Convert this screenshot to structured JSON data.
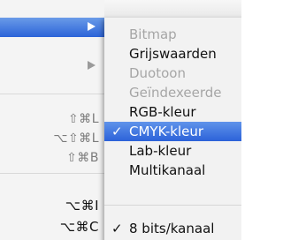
{
  "parent_menu": {
    "shortcuts": {
      "rgb": "⇧⌘L",
      "cmyk": "⌥⇧⌘L",
      "lab": "⇧⌘B",
      "image_size": "⌥⌘I",
      "canvas_size": "⌥⌘C"
    }
  },
  "submenu": {
    "items": [
      {
        "label": "Bitmap",
        "enabled": false
      },
      {
        "label": "Grijswaarden",
        "enabled": true
      },
      {
        "label": "Duotoon",
        "enabled": false
      },
      {
        "label": "Geïndexeerde",
        "enabled": false
      },
      {
        "label": "RGB-kleur",
        "enabled": true
      },
      {
        "label": "CMYK-kleur",
        "enabled": true,
        "selected": true,
        "checked": true
      },
      {
        "label": "Lab-kleur",
        "enabled": true
      },
      {
        "label": "Multikanaal",
        "enabled": true
      }
    ],
    "bits_item": {
      "label": "8 bits/kanaal",
      "checked": true
    },
    "check_glyph": "✓"
  },
  "colors": {
    "selection": "#2c62d9",
    "disabled_text": "#a6a6a6"
  }
}
